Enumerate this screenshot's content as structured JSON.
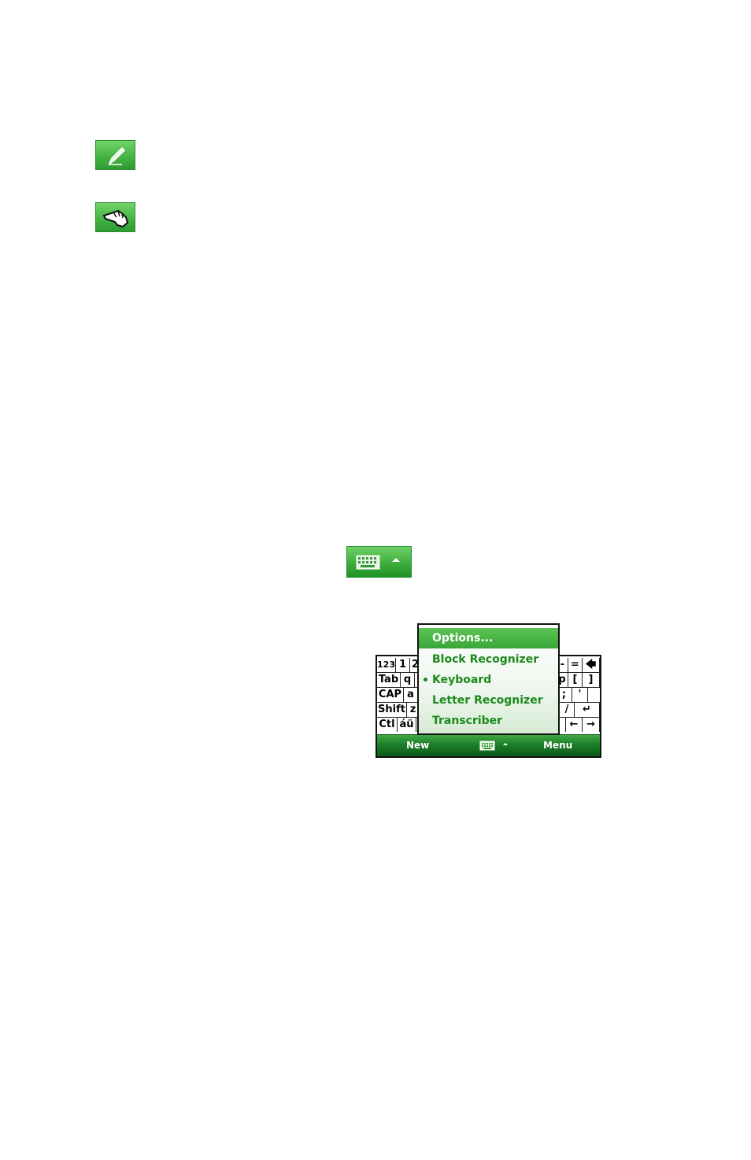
{
  "icons": {
    "pen_icon": "pen-icon",
    "hand_icon": "hand-pointer-icon",
    "keyboard_icon": "keyboard-icon",
    "arrow_icon": "up-arrow-icon",
    "icon_green": "#46b443"
  },
  "keyboard": {
    "left_keys": [
      [
        "123",
        "1",
        "2"
      ],
      [
        "Tab",
        "q",
        ""
      ],
      [
        "CAP",
        "a",
        ""
      ],
      [
        "Shift",
        "z",
        ""
      ],
      [
        "Ctl",
        "áü",
        ""
      ]
    ],
    "right_keys": [
      [
        "-",
        "=",
        "🡄"
      ],
      [
        "p",
        "[",
        "]"
      ],
      [
        ";",
        "'",
        ""
      ],
      [
        "/",
        "↵",
        ""
      ],
      [
        "",
        "←",
        "→"
      ]
    ]
  },
  "menu": {
    "items": [
      {
        "label": "Options...",
        "selected": true,
        "checked": false
      },
      {
        "label": "Block Recognizer",
        "selected": false,
        "checked": false
      },
      {
        "label": "Keyboard",
        "selected": false,
        "checked": true
      },
      {
        "label": "Letter Recognizer",
        "selected": false,
        "checked": false
      },
      {
        "label": "Transcriber",
        "selected": false,
        "checked": false
      }
    ]
  },
  "softkeys": {
    "left": "New",
    "right": "Menu"
  }
}
